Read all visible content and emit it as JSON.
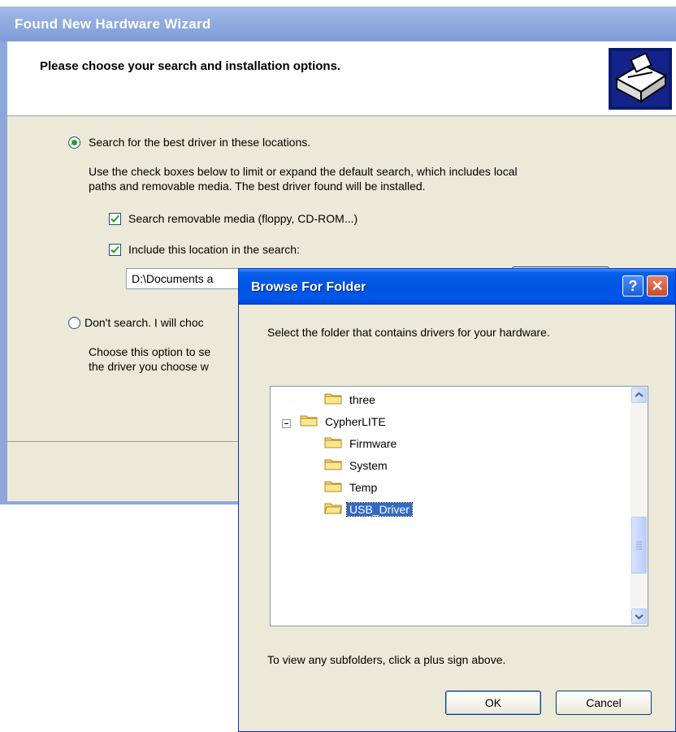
{
  "wizard": {
    "title": "Found New Hardware Wizard",
    "heading": "Please choose your search and installation options.",
    "option_search": {
      "label": "Search for the best driver in these locations.",
      "selected": true,
      "description_line1": "Use the check boxes below to limit or expand the default search, which includes local",
      "description_line2": "paths and removable media. The best driver found will be installed.",
      "check_removable": {
        "label": "Search removable media (floppy, CD-ROM...)",
        "checked": true
      },
      "check_location": {
        "label": "Include this location in the search:",
        "checked": true
      },
      "path_value": "D:\\Documents a"
    },
    "option_manual": {
      "label": "Don't search. I will choc",
      "selected": false,
      "description_line1": "Choose this option to se",
      "description_line2": "the driver you choose w"
    }
  },
  "browse_dialog": {
    "title": "Browse For Folder",
    "help_symbol": "?",
    "close_symbol": "✕",
    "description": "Select the folder that contains drivers for your hardware.",
    "tree": [
      {
        "label": "three",
        "level": 1,
        "selected": false
      },
      {
        "label": "CypherLITE",
        "level": 0,
        "selected": false,
        "expanded": true
      },
      {
        "label": "Firmware",
        "level": 1,
        "selected": false
      },
      {
        "label": "System",
        "level": 1,
        "selected": false
      },
      {
        "label": "Temp",
        "level": 1,
        "selected": false
      },
      {
        "label": "USB_Driver",
        "level": 1,
        "selected": true
      }
    ],
    "hint": "To view any subfolders, click a plus sign above.",
    "ok_label": "OK",
    "cancel_label": "Cancel"
  },
  "colors": {
    "selection": "#316ac5",
    "titlebar_active": "#0054e3",
    "titlebar_inactive": "#8faadf",
    "dialog_face": "#ece9d8",
    "folder": "#f5d76e"
  }
}
